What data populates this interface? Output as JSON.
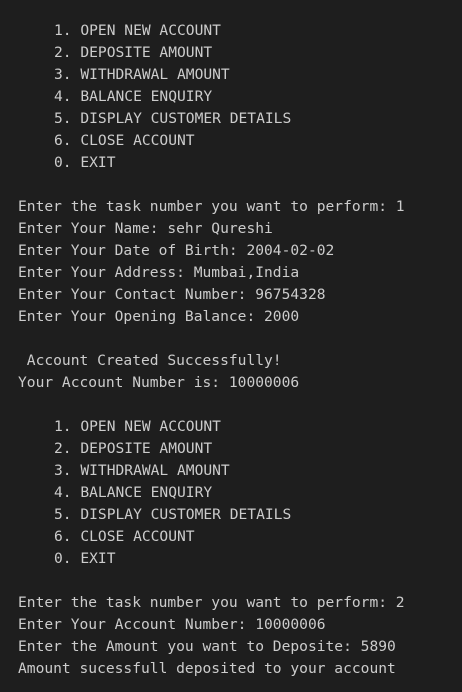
{
  "terminal": {
    "menu1": [
      "1. OPEN NEW ACCOUNT",
      "2. DEPOSITE AMOUNT",
      "3. WITHDRAWAL AMOUNT",
      "4. BALANCE ENQUIRY",
      "5. DISPLAY CUSTOMER DETAILS",
      "6. CLOSE ACCOUNT",
      "0. EXIT"
    ],
    "session1": [
      "Enter the task number you want to perform: 1",
      "Enter Your Name: sehr Qureshi",
      "Enter Your Date of Birth: 2004-02-02",
      "Enter Your Address: Mumbai,India",
      "Enter Your Contact Number: 96754328",
      "Enter Your Opening Balance: 2000"
    ],
    "result1": [
      " Account Created Successfully!",
      "Your Account Number is: 10000006"
    ],
    "menu2": [
      "1. OPEN NEW ACCOUNT",
      "2. DEPOSITE AMOUNT",
      "3. WITHDRAWAL AMOUNT",
      "4. BALANCE ENQUIRY",
      "5. DISPLAY CUSTOMER DETAILS",
      "6. CLOSE ACCOUNT",
      "0. EXIT"
    ],
    "session2": [
      "Enter the task number you want to perform: 2",
      "Enter Your Account Number: 10000006",
      "Enter the Amount you want to Deposite: 5890",
      "Amount sucessfull deposited to your account"
    ]
  },
  "colors": {
    "background": "#1e1e1e",
    "text": "#cccccc"
  }
}
